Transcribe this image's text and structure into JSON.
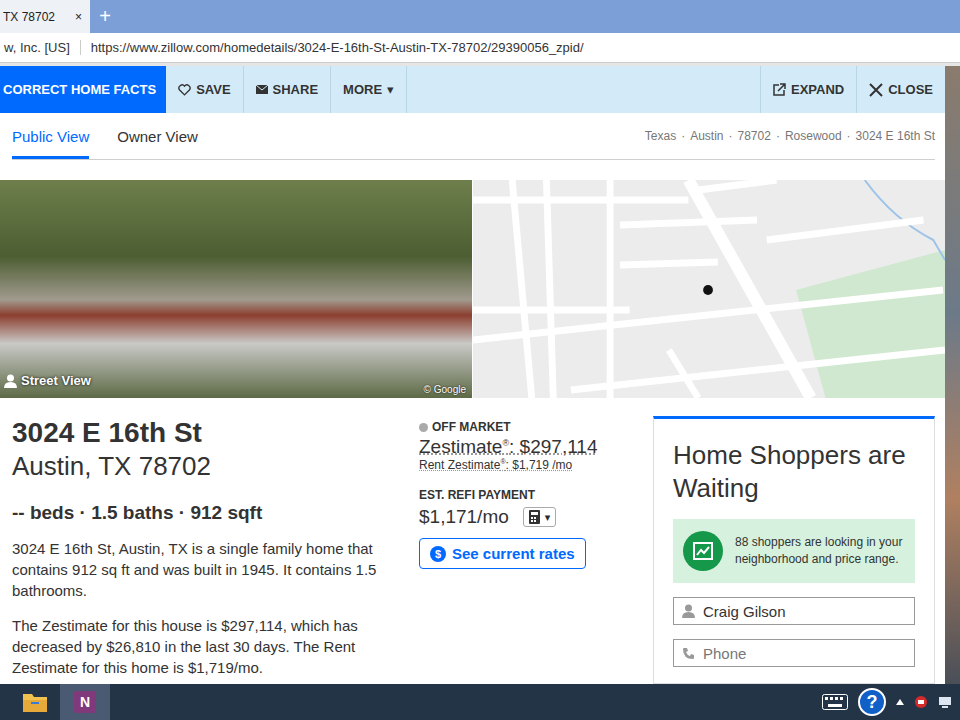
{
  "browser": {
    "tab": {
      "title": "TX 78702",
      "close": "×"
    },
    "new_tab": "+",
    "identity": "w, Inc. [US]",
    "url": "https://www.zillow.com/homedetails/3024-E-16th-St-Austin-TX-78702/29390056_zpid/"
  },
  "toolbar": {
    "primary": "CORRECT HOME FACTS",
    "actions": [
      "SAVE",
      "SHARE",
      "MORE"
    ],
    "caret": "▾",
    "right_actions": [
      "EXPAND",
      "CLOSE"
    ]
  },
  "views": [
    {
      "label": "Public View",
      "selected": true
    },
    {
      "label": "Owner View",
      "selected": false
    }
  ],
  "breadcrumb": {
    "items": [
      "Texas",
      "Austin",
      "78702",
      "Rosewood",
      "3024 E 16th St"
    ],
    "separator": "·"
  },
  "street_view": {
    "label": "Street View",
    "credit": "© Google"
  },
  "home": {
    "street": "3024 E 16th St",
    "city": "Austin, TX 78702",
    "facts": "-- beds · 1.5 baths · 912 sqft",
    "description": [
      "3024 E 16th St, Austin, TX is a single family home that contains 912 sq ft and was built in 1945. It contains 1.5 bathrooms.",
      "The Zestimate for this house is $297,114, which has decreased by $26,810 in the last 30 days. The Rent Zestimate for this home is $1,719/mo."
    ]
  },
  "valuation": {
    "status": "OFF MARKET",
    "zestimate": {
      "label": "Zestimate",
      "mark": "®",
      "value": ": $297,114"
    },
    "rent": {
      "label": "Rent Zestimate",
      "mark": "®",
      "value": ": $1,719 /mo"
    },
    "refi_label": "EST. REFI PAYMENT",
    "refi_value": "$1,171/mo",
    "caret": "▾",
    "rates_icon": "$",
    "rates_button": "See current rates"
  },
  "lead_form": {
    "title": "Home Shoppers are Waiting",
    "notice": "88 shoppers are looking in your neighborhood and price range.",
    "fields": [
      {
        "value": "Craig Gilson",
        "placeholder": false
      },
      {
        "value": "Phone",
        "placeholder": true
      }
    ]
  },
  "taskbar": {
    "onenote": {
      "glyph": "N",
      "selected": true
    },
    "help": "?"
  }
}
